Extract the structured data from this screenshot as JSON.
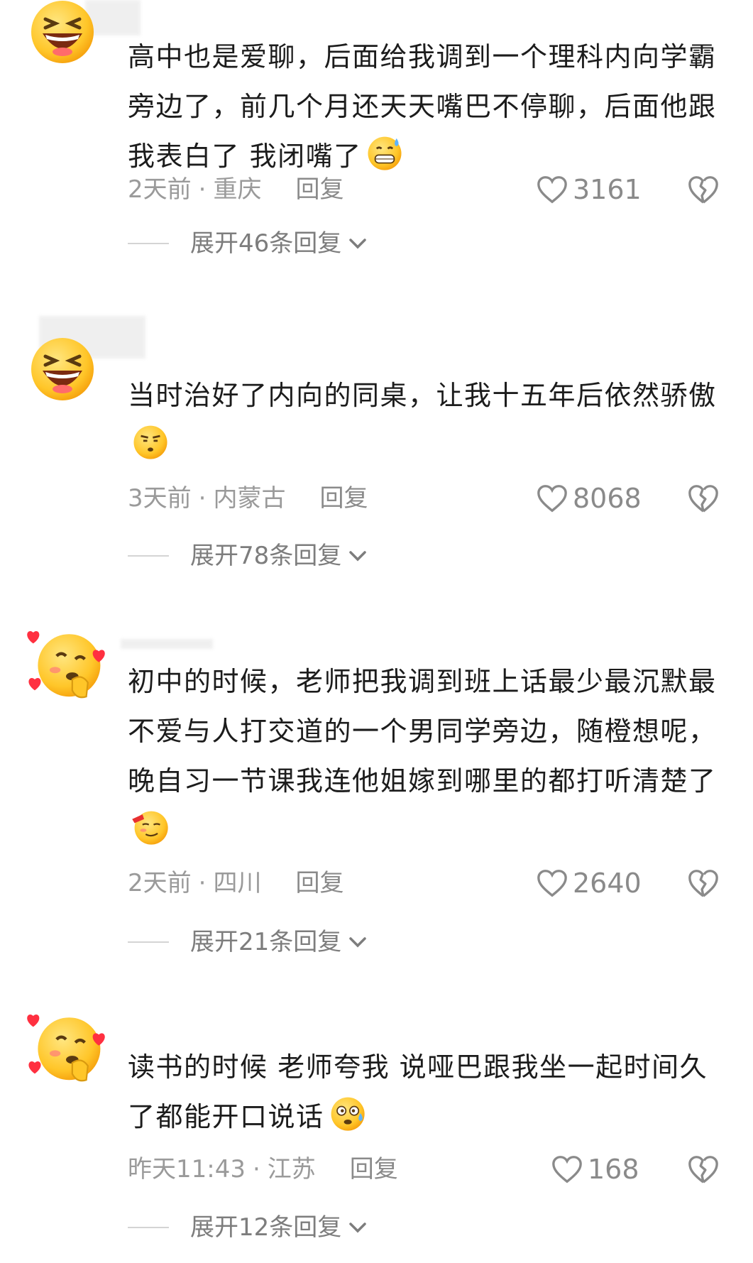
{
  "comments": [
    {
      "avatar_icon": "grinning-squint-face-icon",
      "text": "高中也是爱聊，后面给我调到一个理科内向学霸旁边了，前几个月还天天嘴巴不停聊，后面他跟我表白了 我闭嘴了",
      "emoji_icon": "grinning-sweat-face-icon",
      "time": "2天前",
      "location": "重庆",
      "reply_label": "回复",
      "likes": "3161",
      "expand_label": "展开46条回复"
    },
    {
      "avatar_icon": "grinning-squint-face-icon",
      "text": "当时治好了内向的同桌，让我十五年后依然骄傲",
      "emoji_icon": "smug-face-icon",
      "time": "3天前",
      "location": "内蒙古",
      "reply_label": "回复",
      "likes": "8068",
      "expand_label": "展开78条回复"
    },
    {
      "avatar_icon": "winking-hearts-face-icon",
      "text": "初中的时候，老师把我调到班上话最少最沉默最不爱与人打交道的一个男同学旁边，随橙想呢，晚自习一节课我连他姐嫁到哪里的都打听清楚了",
      "emoji_icon": "proud-blush-face-icon",
      "time": "2天前",
      "location": "四川",
      "reply_label": "回复",
      "likes": "2640",
      "expand_label": "展开21条回复"
    },
    {
      "avatar_icon": "winking-hearts-face-icon",
      "text": "读书的时候 老师夸我 说哑巴跟我坐一起时间久了都能开口说话",
      "emoji_icon": "dizzy-sweat-face-icon",
      "time": "昨天11:43",
      "location": "江苏",
      "reply_label": "回复",
      "likes": "168",
      "expand_label": "展开12条回复"
    }
  ],
  "colors": {
    "meta": "#9a9a9a",
    "text": "#1c1c1c",
    "emoji_yellow": "#ffc629"
  }
}
